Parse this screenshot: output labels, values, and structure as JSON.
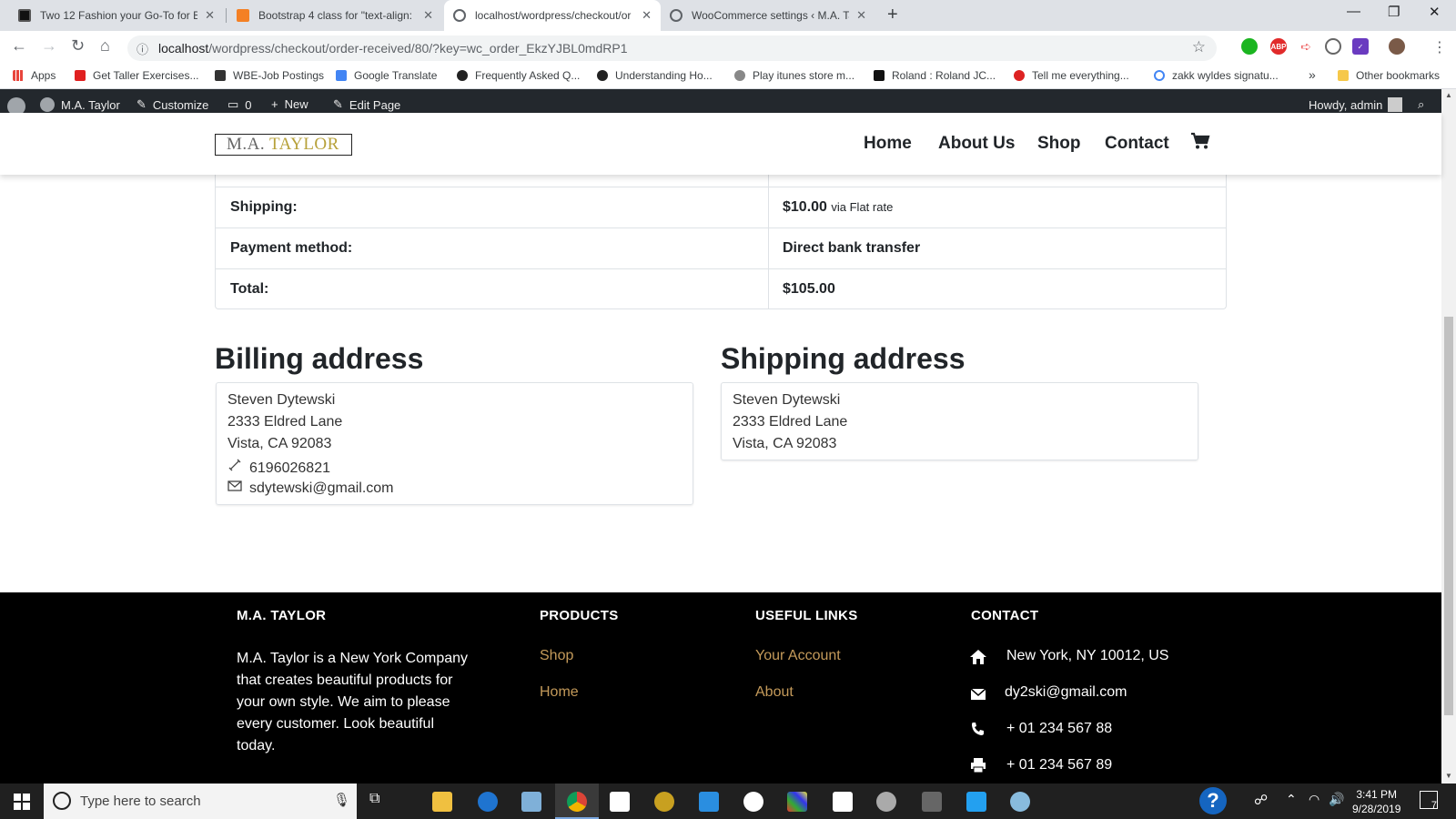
{
  "browser": {
    "tabs": [
      {
        "title": "Two 12 Fashion your Go-To for B",
        "active": false
      },
      {
        "title": "Bootstrap 4 class for \"text-align: ",
        "active": false
      },
      {
        "title": "localhost/wordpress/checkout/or",
        "active": true
      },
      {
        "title": "WooCommerce settings ‹ M.A. Ta",
        "active": false
      }
    ],
    "url_host": "localhost",
    "url_path": "/wordpress/checkout/order-received/80/?key=wc_order_EkzYJBL0mdRP1",
    "bookmarks": [
      "Apps",
      "Get Taller Exercises...",
      "WBE-Job Postings",
      "Google Translate",
      "Frequently Asked Q...",
      "Understanding Ho...",
      "Play itunes store m...",
      "Roland : Roland JC...",
      "Tell me everything...",
      "zakk wyldes signatu..."
    ],
    "other_bookmarks": "Other bookmarks",
    "more_bookmarks": "»"
  },
  "adminbar": {
    "site": "M.A. Taylor",
    "customize": "Customize",
    "comments": "0",
    "new": "New",
    "edit": "Edit Page",
    "howdy": "Howdy, admin"
  },
  "header": {
    "logo_part1": "M.A.",
    "logo_part2": "TAYLOR",
    "nav": [
      "Home",
      "About Us",
      "Shop",
      "Contact"
    ]
  },
  "order": {
    "rows": [
      {
        "label": "Shipping:",
        "value": "$10.00",
        "note": "via Flat rate"
      },
      {
        "label": "Payment method:",
        "value": "Direct bank transfer"
      },
      {
        "label": "Total:",
        "value": "$105.00"
      }
    ]
  },
  "billing": {
    "heading": "Billing address",
    "name": "Steven Dytewski",
    "street": "2333 Eldred Lane",
    "city": "Vista, CA 92083",
    "phone": "6196026821",
    "email": "sdytewski@gmail.com"
  },
  "shipping": {
    "heading": "Shipping address",
    "name": "Steven Dytewski",
    "street": "2333 Eldred Lane",
    "city": "Vista, CA 92083"
  },
  "footer": {
    "col1_title": "M.A. TAYLOR",
    "col1_text": "M.A. Taylor is a New York Company that creates beautiful products for your own style. We aim to please every customer. Look beautiful today.",
    "col2_title": "PRODUCTS",
    "col2_links": [
      "Shop",
      "Home"
    ],
    "col3_title": "USEFUL LINKS",
    "col3_links": [
      "Your Account",
      "About"
    ],
    "col4_title": "CONTACT",
    "contact": {
      "address": "New York, NY 10012, US",
      "email": "dy2ski@gmail.com",
      "phone": "+ 01 234 567 88",
      "fax": "+ 01 234 567 89"
    },
    "link_color": "#c49a5a"
  },
  "taskbar": {
    "search_placeholder": "Type here to search",
    "time": "3:41 PM",
    "date": "9/28/2019",
    "notifications": "7"
  }
}
